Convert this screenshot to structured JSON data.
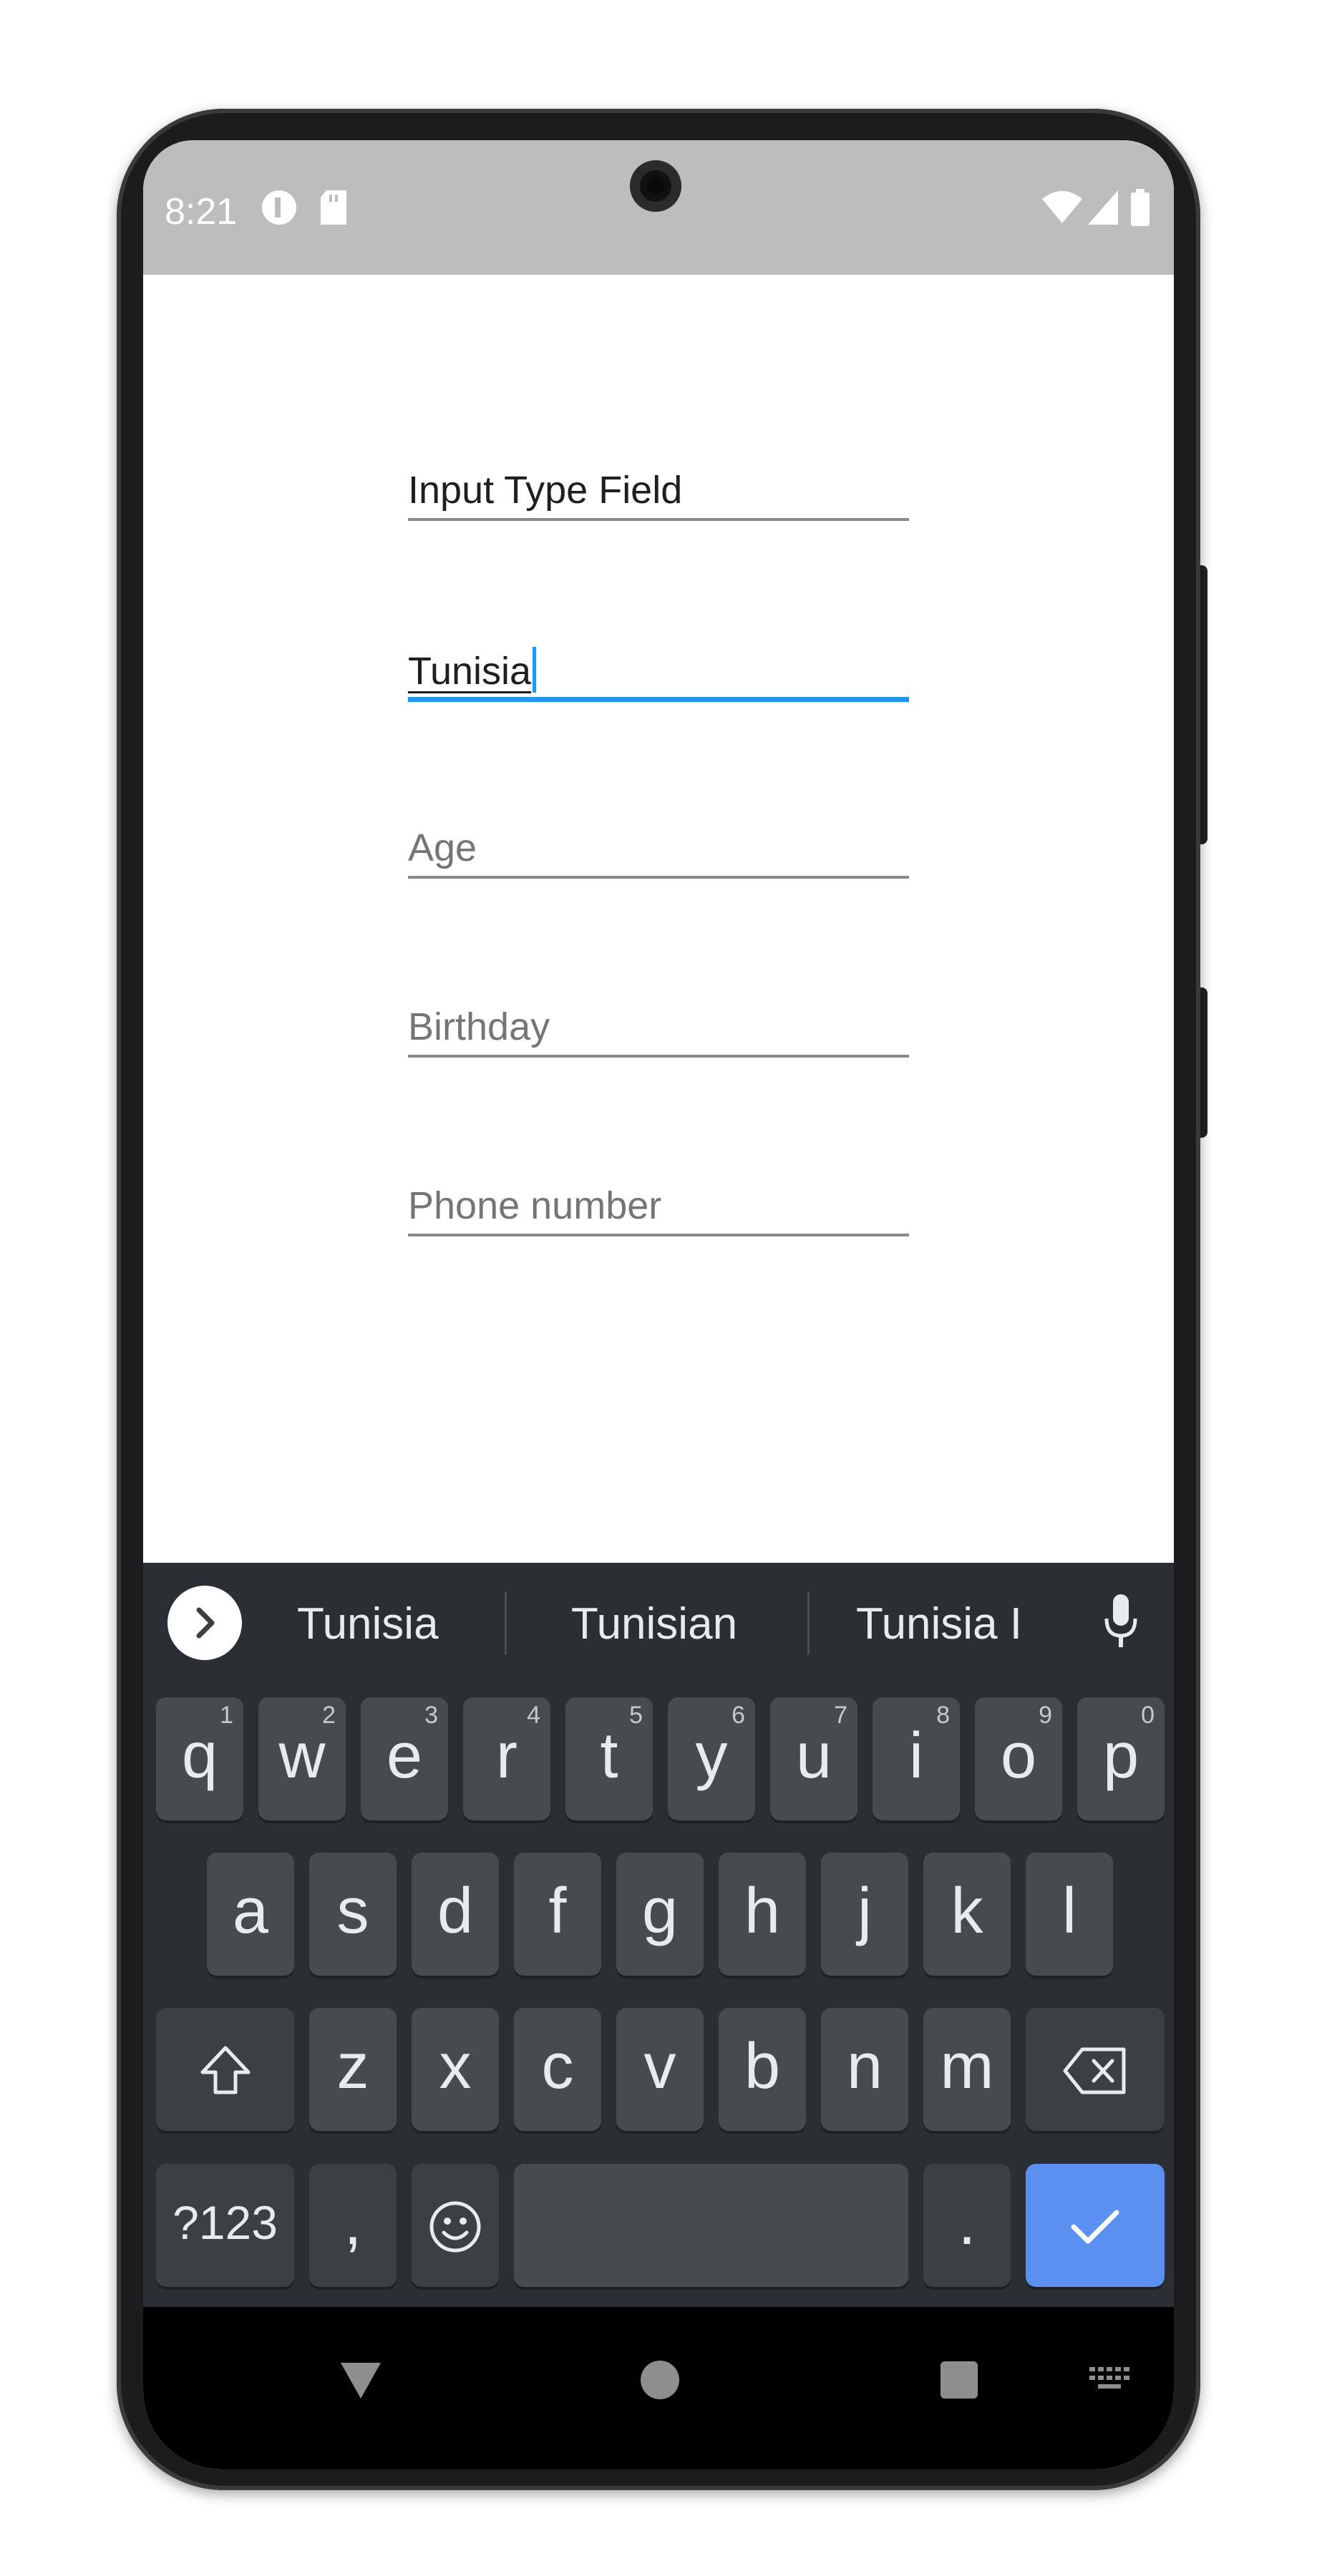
{
  "status_bar": {
    "time": "8:21"
  },
  "form": {
    "name_value": "Input Type Field",
    "country_value": "Tunisia",
    "age_placeholder": "Age",
    "birthday_placeholder": "Birthday",
    "phone_placeholder": "Phone number",
    "focus_color": "#2196f3"
  },
  "keyboard": {
    "suggestions": [
      "Tunisia",
      "Tunisian",
      "Tunisia I"
    ],
    "row1": [
      {
        "key": "q",
        "hint": "1"
      },
      {
        "key": "w",
        "hint": "2"
      },
      {
        "key": "e",
        "hint": "3"
      },
      {
        "key": "r",
        "hint": "4"
      },
      {
        "key": "t",
        "hint": "5"
      },
      {
        "key": "y",
        "hint": "6"
      },
      {
        "key": "u",
        "hint": "7"
      },
      {
        "key": "i",
        "hint": "8"
      },
      {
        "key": "o",
        "hint": "9"
      },
      {
        "key": "p",
        "hint": "0"
      }
    ],
    "row2": [
      "a",
      "s",
      "d",
      "f",
      "g",
      "h",
      "j",
      "k",
      "l"
    ],
    "row3": [
      "z",
      "x",
      "c",
      "v",
      "b",
      "n",
      "m"
    ],
    "symbols_label": "?123",
    "comma_label": ",",
    "period_label": ".",
    "enter_color": "#5b8ff0",
    "icons": [
      "shift-icon",
      "backspace-icon",
      "emoji-icon",
      "checkmark-icon",
      "chevron-right-icon",
      "microphone-icon"
    ]
  },
  "nav_bar": {
    "icons": [
      "back-triangle-icon",
      "home-circle-icon",
      "recents-square-icon",
      "keyboard-switch-icon"
    ]
  }
}
